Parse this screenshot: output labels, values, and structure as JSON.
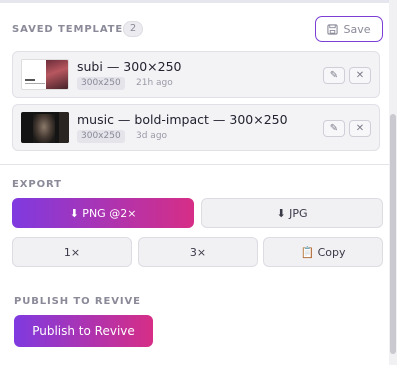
{
  "saved_templates": {
    "heading": "SAVED TEMPLATES",
    "count": "2",
    "save_label": "Save",
    "items": [
      {
        "name": "subi — 300×250",
        "size": "300x250",
        "time": "21h ago"
      },
      {
        "name": "music — bold-impact — 300×250",
        "size": "300x250",
        "time": "3d ago"
      }
    ],
    "edit_glyph": "✎",
    "delete_glyph": "✕"
  },
  "export": {
    "heading": "EXPORT",
    "png_label": "⬇ PNG @2×",
    "jpg_label": "⬇ JPG",
    "scale_1x": "1×",
    "scale_3x": "3×",
    "copy_label": "📋 Copy"
  },
  "publish": {
    "heading": "PUBLISH TO REVIVE",
    "button_label": "Publish to Revive"
  },
  "colors": {
    "accent_start": "#7f3ae0",
    "accent_end": "#d62e86",
    "border_accent": "#7b3fd6"
  }
}
